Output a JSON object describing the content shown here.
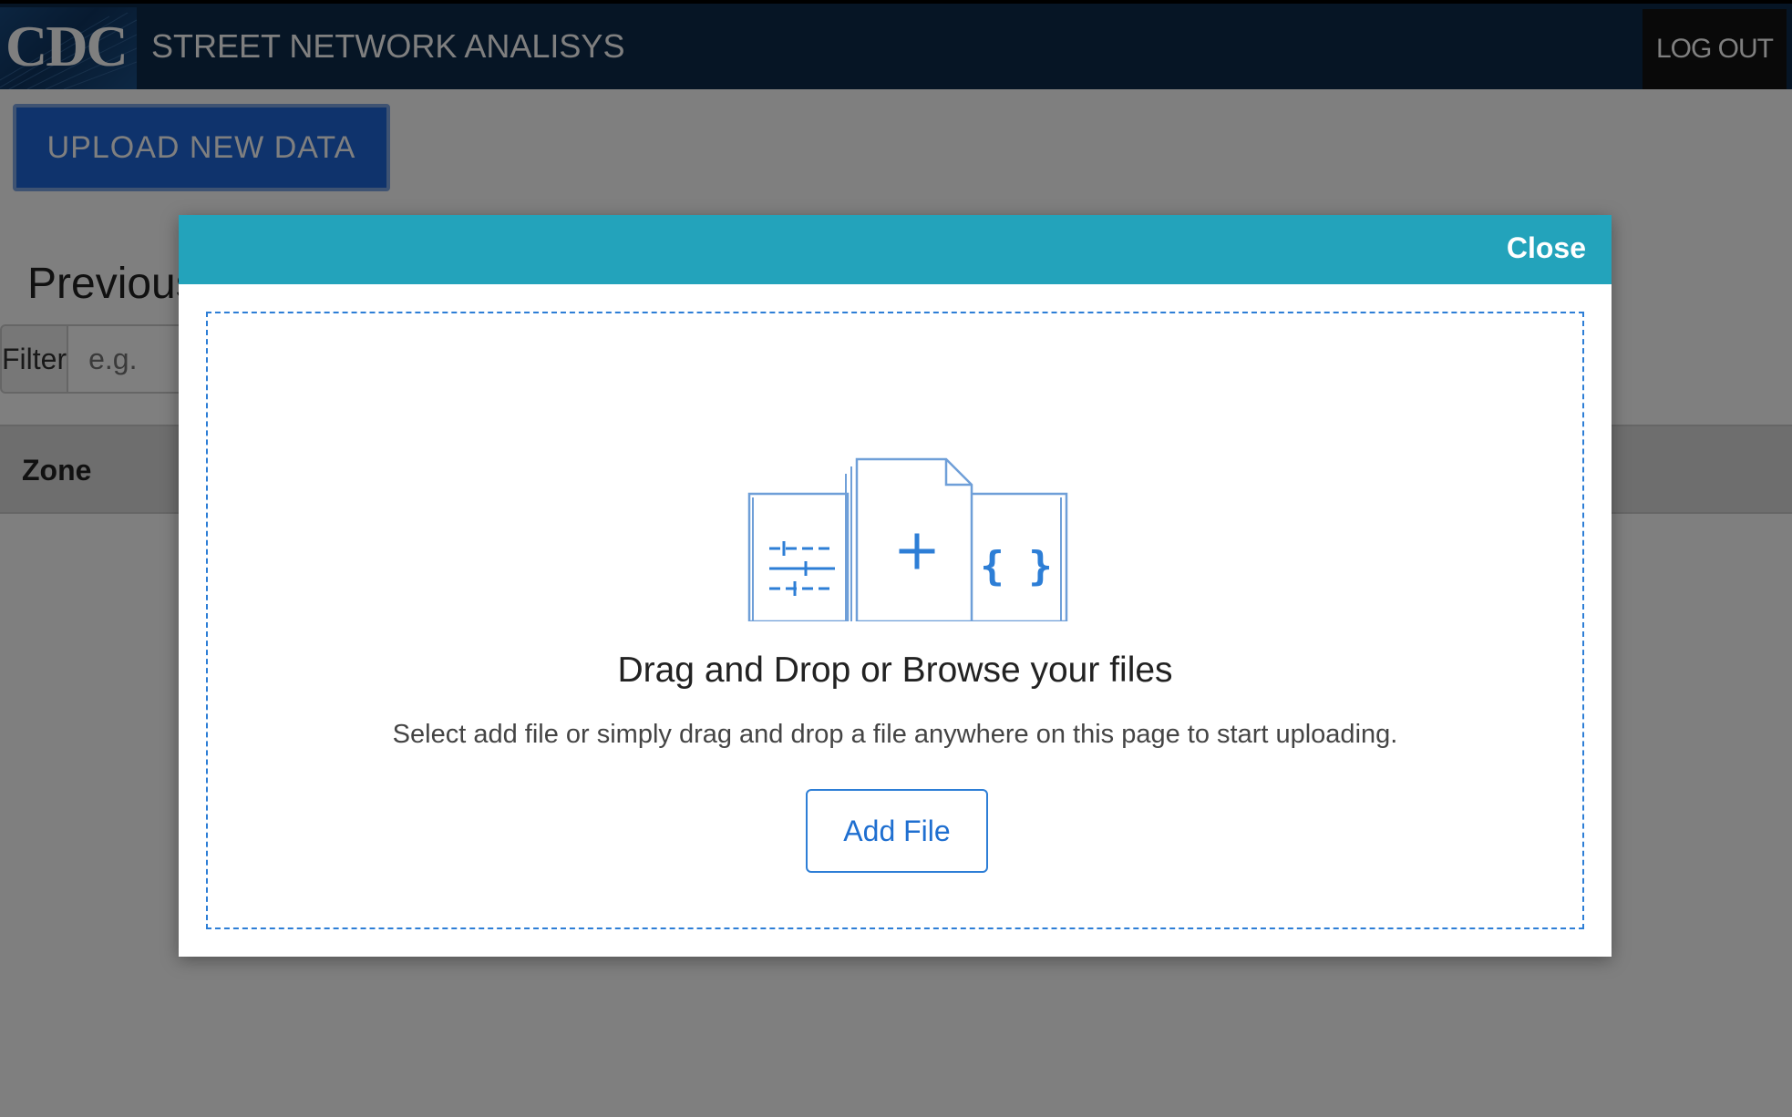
{
  "header": {
    "logo_text": "CDC",
    "app_title": "STREET NETWORK ANALISYS",
    "logout_label": "LOG OUT"
  },
  "main": {
    "upload_button_label": "UPLOAD NEW DATA",
    "previous_heading": "Previous",
    "filter": {
      "label": "Filter",
      "placeholder": "e.g."
    },
    "table": {
      "columns": [
        "Zone"
      ]
    }
  },
  "modal": {
    "close_label": "Close",
    "dropzone": {
      "title": "Drag and Drop or Browse your files",
      "subtitle": "Select add file or simply drag and drop a file anywhere on this page to start uploading.",
      "add_file_label": "Add File"
    },
    "icons": [
      "sliders-file-icon",
      "add-file-icon",
      "json-file-icon"
    ]
  },
  "colors": {
    "header_bg": "#0c2a4b",
    "modal_header": "#23a3bb",
    "accent_blue": "#1f6fd0",
    "upload_button": "#1e66d8"
  }
}
